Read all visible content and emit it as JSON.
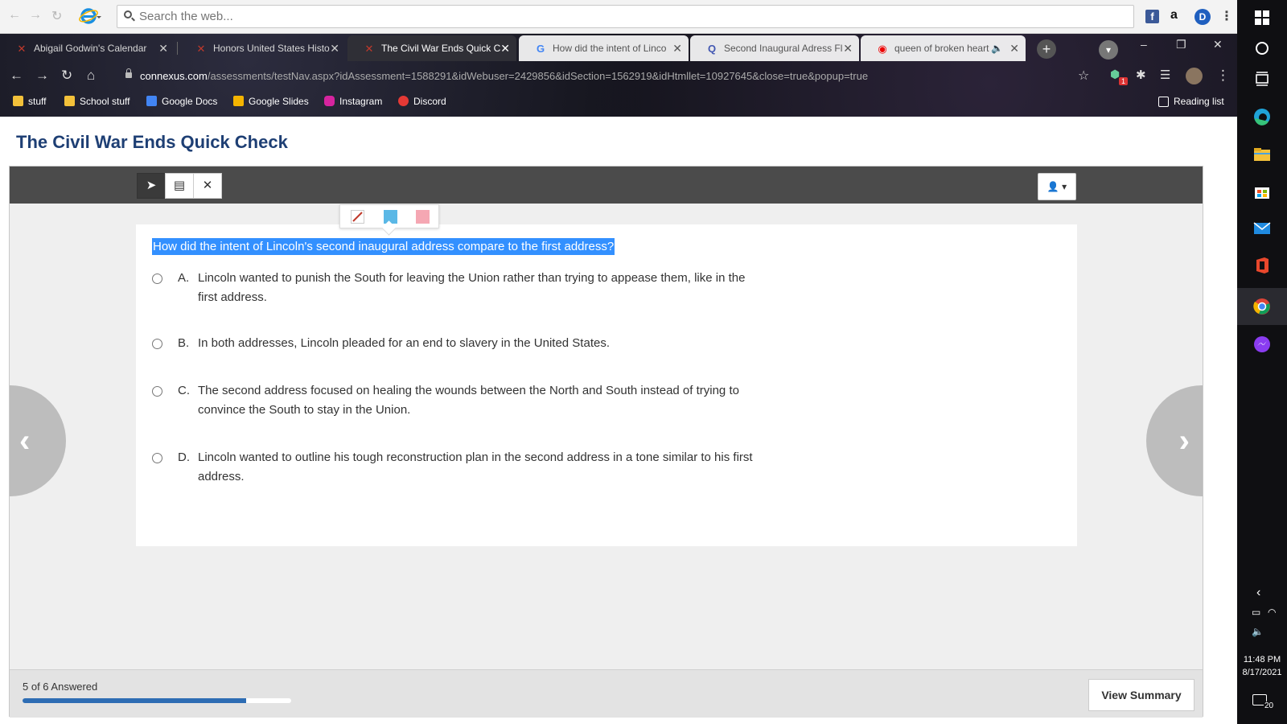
{
  "search_toolbar": {
    "placeholder": "Search the web..."
  },
  "tabs": [
    {
      "label": "Abigail Godwin's Calendar",
      "icon": "connexus-icon"
    },
    {
      "label": "Honors United States Histo",
      "icon": "connexus-icon"
    },
    {
      "label": "The Civil War Ends Quick C",
      "icon": "connexus-icon",
      "active": true
    },
    {
      "label": "How did the intent of Linco",
      "icon": "google-icon"
    },
    {
      "label": "Second Inaugural Adress Fl",
      "icon": "quizlet-icon"
    },
    {
      "label": "queen of broken heart",
      "icon": "youtube-icon"
    }
  ],
  "address_bar": {
    "domain": "connexus.com",
    "path": "/assessments/testNav.aspx?idAssessment=1588291&idWebuser=2429856&idSection=1562919&idHtmllet=10927645&close=true&popup=true"
  },
  "extension_badge": "1",
  "bookmarks": [
    {
      "label": "stuff",
      "icon": "folder-icon",
      "color": "#f3c13a"
    },
    {
      "label": "School stuff",
      "icon": "folder-icon",
      "color": "#f3c13a"
    },
    {
      "label": "Google Docs",
      "icon": "docs-icon",
      "color": "#4285f4"
    },
    {
      "label": "Google Slides",
      "icon": "slides-icon",
      "color": "#f4b400"
    },
    {
      "label": "Instagram",
      "icon": "instagram-icon",
      "color": "#d6249f"
    },
    {
      "label": "Discord",
      "icon": "discord-icon",
      "color": "#e53935"
    }
  ],
  "reading_list": "Reading list",
  "page": {
    "title": "The Civil War Ends Quick Check",
    "question": "How did the intent of Lincoln's second inaugural address compare to the first address?",
    "options": [
      {
        "letter": "A.",
        "text": "Lincoln wanted to punish the South for leaving the Union rather than trying to appease them, like in the first address."
      },
      {
        "letter": "B.",
        "text": "In both addresses, Lincoln pleaded for an end to slavery in the United States."
      },
      {
        "letter": "C.",
        "text": "The second address focused on healing the wounds between the North and South instead of trying to convince the South to stay in the Union."
      },
      {
        "letter": "D.",
        "text": "Lincoln wanted to outline his tough reconstruction plan in the second address in a tone similar to his first address."
      }
    ],
    "answered_text": "5 of 6 Answered",
    "progress_fraction": 0.833,
    "view_summary": "View Summary"
  },
  "highlighter_colors": {
    "blue": "#5bb8e6",
    "pink": "#f5a7b3"
  },
  "clock": {
    "time": "11:48 PM",
    "date": "8/17/2021"
  },
  "notification_count": "20"
}
